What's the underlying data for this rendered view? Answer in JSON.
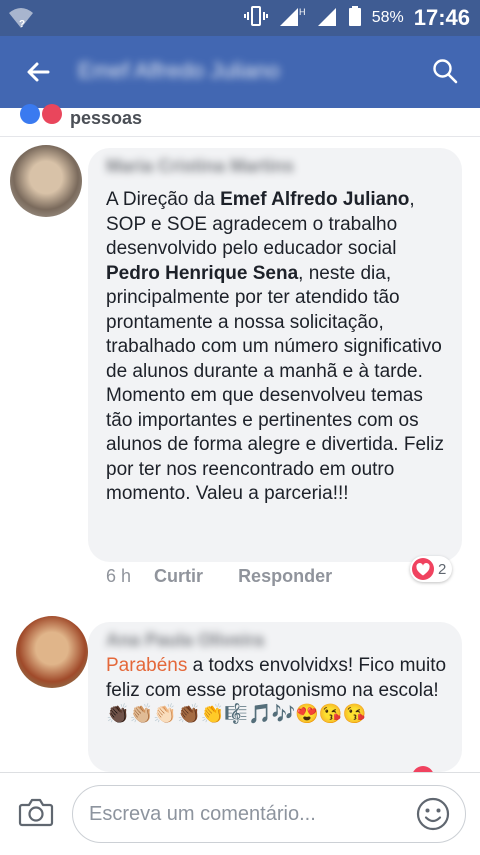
{
  "status_bar": {
    "battery_percent": "58%",
    "time": "17:46",
    "network_label": "H"
  },
  "header": {
    "title": "Emef Alfredo Juliano"
  },
  "reactions_summary": {
    "text": "pessoas"
  },
  "comments": [
    {
      "author": "Maria Cristina Martins",
      "text_parts": [
        {
          "t": "A Direção da "
        },
        {
          "t": "Emef Alfredo Juliano",
          "b": true
        },
        {
          "t": ", SOP e SOE agradecem o trabalho desenvolvido pelo educador social "
        },
        {
          "t": "Pedro Henrique Sena",
          "b": true
        },
        {
          "t": ", neste dia, principalmente por ter atendido tão prontamente a nossa solicitação, trabalhado com um número significativo de alunos durante a manhã e à tarde. Momento em que desenvolveu temas tão importantes e pertinentes com os alunos de forma alegre e divertida. Feliz por ter nos reencontrado em outro momento. Valeu a parceria!!!"
        }
      ],
      "time": "6 h",
      "like_label": "Curtir",
      "reply_label": "Responder",
      "reaction_count": "2"
    },
    {
      "author": "Ana Paula Oliveira",
      "mention": "Parabéns",
      "text_after": " a todxs envolvidxs! Fico muito feliz com esse protagonismo na escola! 👏🏿👏🏼👏🏻👏🏾👏🎼🎵🎶😍😘😘"
    }
  ],
  "composer": {
    "placeholder": "Escreva um comentário..."
  },
  "colors": {
    "header_bg": "#4267b2",
    "status_bg": "#3f5c93",
    "bubble_bg": "#f2f3f5",
    "mention": "#e4683a",
    "heart": "#f0425f"
  }
}
